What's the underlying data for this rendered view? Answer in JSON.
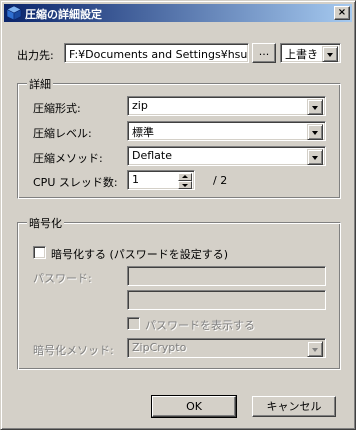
{
  "window": {
    "title": "圧縮の詳細設定",
    "icon": "app-cube-icon",
    "close_glyph": "×"
  },
  "output": {
    "label": "出力先:",
    "path": "F:¥Documents and Settings¥hsur¥デ",
    "browse_label": "...",
    "mode_value": "上書き"
  },
  "details": {
    "legend": "詳細",
    "format_label": "圧縮形式:",
    "format_value": "zip",
    "level_label": "圧縮レベル:",
    "level_value": "標準",
    "method_label": "圧縮メソッド:",
    "method_value": "Deflate",
    "threads_label": "CPU スレッド数:",
    "threads_value": "1",
    "threads_max": "/ 2"
  },
  "encryption": {
    "legend": "暗号化",
    "enable_label": "暗号化する (パスワードを設定する)",
    "enable_checked": false,
    "password_label": "パスワード:",
    "password_value": "",
    "password_confirm_value": "",
    "show_password_label": "パスワードを表示する",
    "show_password_checked": false,
    "method_label": "暗号化メソッド:",
    "method_value": "ZipCrypto"
  },
  "footer": {
    "ok_label": "OK",
    "cancel_label": "キャンセル"
  },
  "colors": {
    "face": "#d4d0c8",
    "title_start": "#0a246a",
    "title_end": "#a6caf0",
    "disabled_text": "#808080"
  }
}
